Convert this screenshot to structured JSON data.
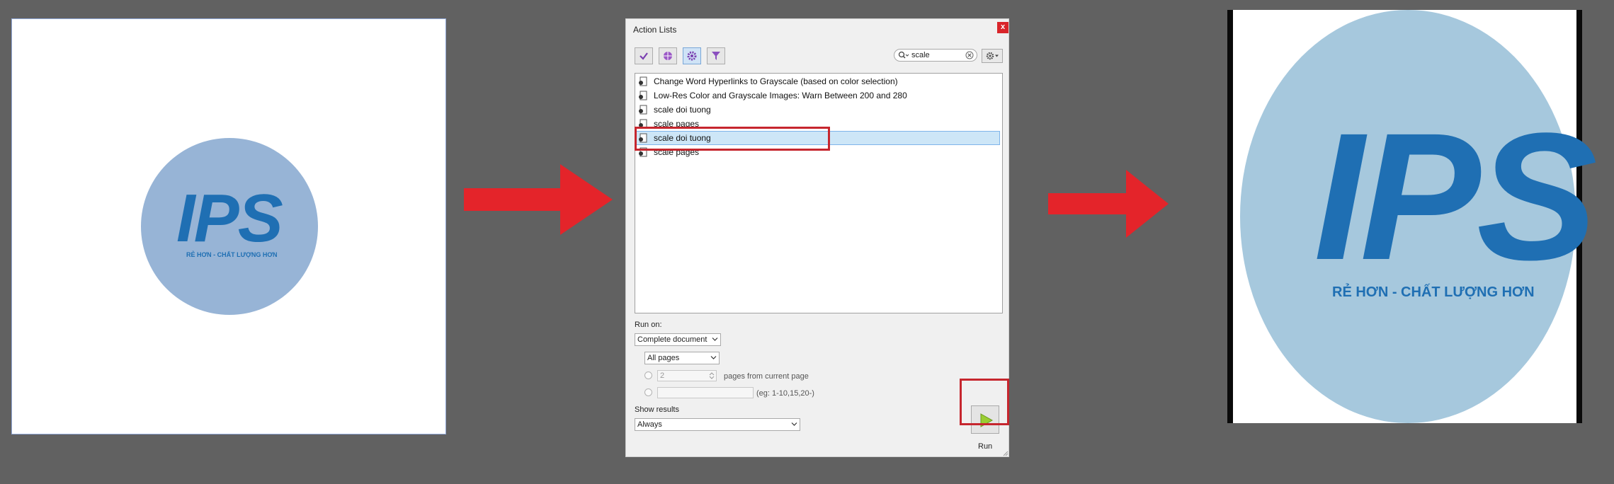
{
  "left_panel": {
    "logo_text": "IPS",
    "tagline": "RẺ HƠN - CHẤT LƯỢNG HƠN"
  },
  "dialog": {
    "title": "Action Lists",
    "close_label": "x",
    "toolbar": {
      "buttons": [
        "checkmark-icon",
        "globe-icon",
        "gear-icon",
        "filter-icon"
      ],
      "search_value": "scale",
      "options_icon": "gear-icon"
    },
    "actions": [
      {
        "label": "Change Word Hyperlinks to Grayscale (based on color selection)",
        "selected": false
      },
      {
        "label": "Low-Res Color and Grayscale Images: Warn Between 200 and 280",
        "selected": false
      },
      {
        "label": "scale doi tuong",
        "selected": false
      },
      {
        "label": "scale pages",
        "selected": false
      },
      {
        "label": "scale doi tuong",
        "selected": true
      },
      {
        "label": "scale pages",
        "selected": false
      }
    ],
    "run_on": {
      "label": "Run on:",
      "scope_value": "Complete document",
      "pages_value": "All pages",
      "pages_count_value": "2",
      "pages_from_label": "pages from current page",
      "range_hint": "(eg: 1-10,15,20-)"
    },
    "show_results": {
      "label": "Show results",
      "value": "Always"
    },
    "run_label": "Run"
  },
  "right_panel": {
    "logo_text": "IPS",
    "tagline": "RẺ HƠN - CHẤT LƯỢNG HƠN"
  },
  "colors": {
    "background": "#616161",
    "arrow": "#e4242a",
    "logo_blue": "#1f6fb3",
    "left_circle": "#97b4d6",
    "right_ellipse": "#a6c8dd",
    "highlight_box": "#c6262e"
  }
}
